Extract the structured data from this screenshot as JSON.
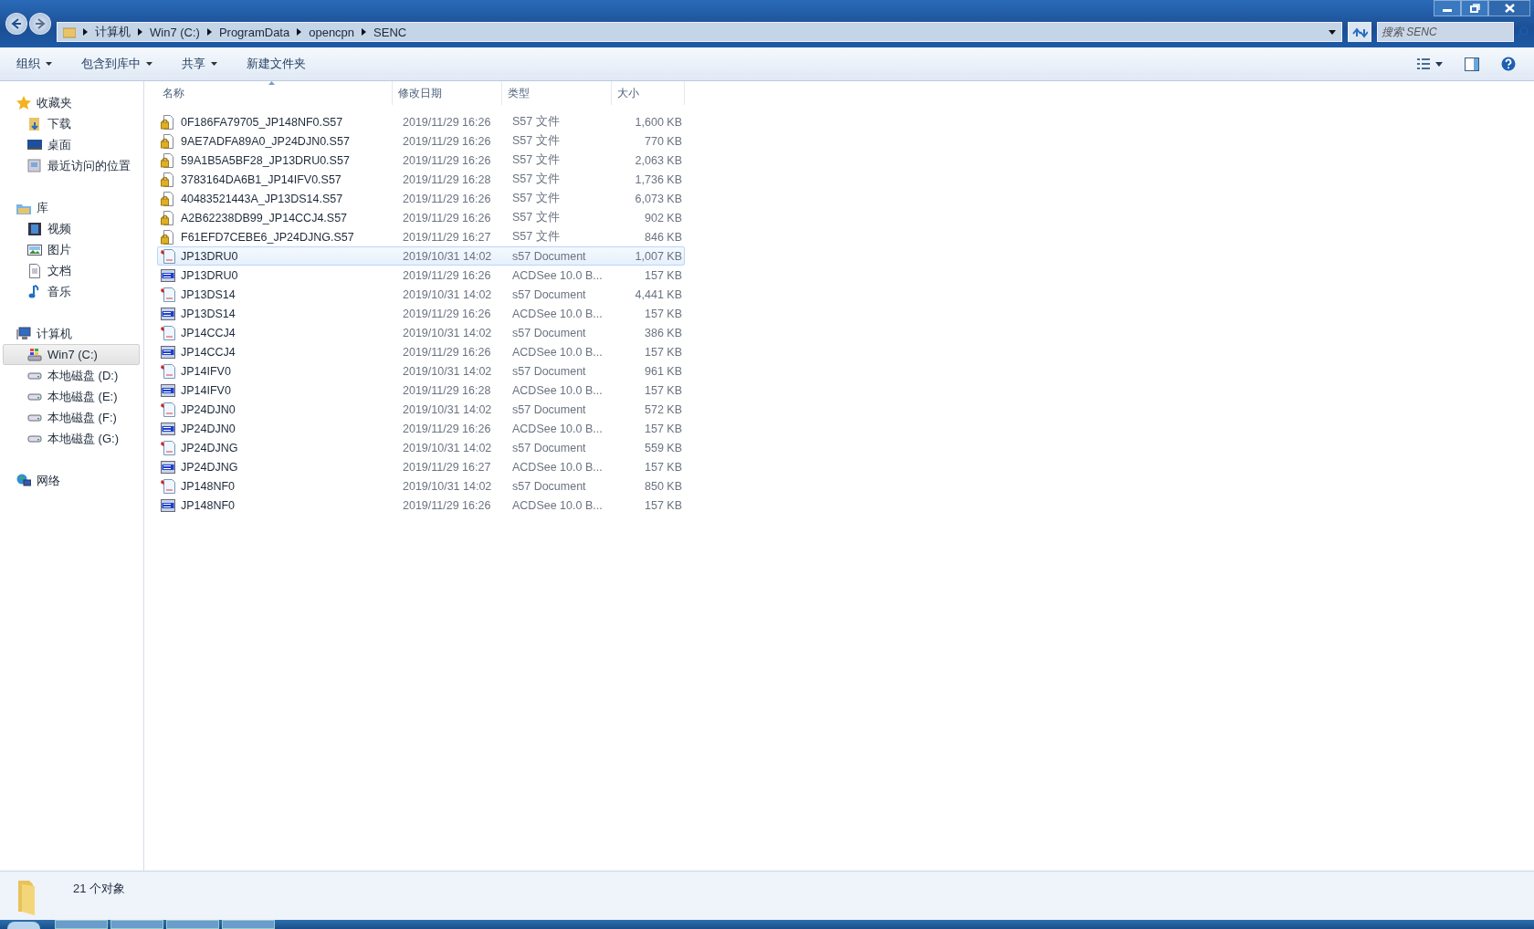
{
  "address_bar": {
    "breadcrumbs": [
      "计算机",
      "Win7 (C:)",
      "ProgramData",
      "opencpn",
      "SENC"
    ]
  },
  "search": {
    "placeholder": "搜索 SENC"
  },
  "toolbar": {
    "items": [
      {
        "label": "组织",
        "dropdown": true
      },
      {
        "label": "包含到库中",
        "dropdown": true
      },
      {
        "label": "共享",
        "dropdown": true
      },
      {
        "label": "新建文件夹",
        "dropdown": false
      }
    ]
  },
  "sidebar": {
    "groups": [
      {
        "label": "收藏夹",
        "kind": "favorites",
        "children": [
          {
            "label": "下载",
            "kind": "download",
            "selected": false
          },
          {
            "label": "桌面",
            "kind": "desktop",
            "selected": false
          },
          {
            "label": "最近访问的位置",
            "kind": "recent",
            "selected": false
          }
        ]
      },
      {
        "label": "库",
        "kind": "library",
        "children": [
          {
            "label": "视频",
            "kind": "video",
            "selected": false
          },
          {
            "label": "图片",
            "kind": "picture",
            "selected": false
          },
          {
            "label": "文档",
            "kind": "document",
            "selected": false
          },
          {
            "label": "音乐",
            "kind": "music",
            "selected": false
          }
        ]
      },
      {
        "label": "计算机",
        "kind": "computer",
        "children": [
          {
            "label": "Win7 (C:)",
            "kind": "system-drive",
            "selected": true
          },
          {
            "label": "本地磁盘 (D:)",
            "kind": "drive",
            "selected": false
          },
          {
            "label": "本地磁盘 (E:)",
            "kind": "drive",
            "selected": false
          },
          {
            "label": "本地磁盘 (F:)",
            "kind": "drive",
            "selected": false
          },
          {
            "label": "本地磁盘 (G:)",
            "kind": "drive",
            "selected": false
          }
        ]
      },
      {
        "label": "网络",
        "kind": "network"
      }
    ]
  },
  "table": {
    "columns": [
      "名称",
      "修改日期",
      "类型",
      "大小"
    ],
    "rows": [
      {
        "kind": "locked",
        "name": "0F186FA79705_JP148NF0.S57",
        "date": "2019/11/29 16:26",
        "type": "S57 文件",
        "size": "1,600 KB",
        "selected": false
      },
      {
        "kind": "locked",
        "name": "9AE7ADFA89A0_JP24DJN0.S57",
        "date": "2019/11/29 16:26",
        "type": "S57 文件",
        "size": "770 KB",
        "selected": false
      },
      {
        "kind": "locked",
        "name": "59A1B5A5BF28_JP13DRU0.S57",
        "date": "2019/11/29 16:26",
        "type": "S57 文件",
        "size": "2,063 KB",
        "selected": false
      },
      {
        "kind": "locked",
        "name": "3783164DA6B1_JP14IFV0.S57",
        "date": "2019/11/29 16:28",
        "type": "S57 文件",
        "size": "1,736 KB",
        "selected": false
      },
      {
        "kind": "locked",
        "name": "40483521443A_JP13DS14.S57",
        "date": "2019/11/29 16:26",
        "type": "S57 文件",
        "size": "6,073 KB",
        "selected": false
      },
      {
        "kind": "locked",
        "name": "A2B62238DB99_JP14CCJ4.S57",
        "date": "2019/11/29 16:26",
        "type": "S57 文件",
        "size": "902 KB",
        "selected": false
      },
      {
        "kind": "locked",
        "name": "F61EFD7CEBE6_JP24DJNG.S57",
        "date": "2019/11/29 16:27",
        "type": "S57 文件",
        "size": "846 KB",
        "selected": false
      },
      {
        "kind": "document",
        "name": "JP13DRU0",
        "date": "2019/10/31 14:02",
        "type": "s57 Document",
        "size": "1,007 KB",
        "selected": true
      },
      {
        "kind": "bmp",
        "name": "JP13DRU0",
        "date": "2019/11/29 16:26",
        "type": "ACDSee 10.0 B...",
        "size": "157 KB",
        "selected": false
      },
      {
        "kind": "document",
        "name": "JP13DS14",
        "date": "2019/10/31 14:02",
        "type": "s57 Document",
        "size": "4,441 KB",
        "selected": false
      },
      {
        "kind": "bmp",
        "name": "JP13DS14",
        "date": "2019/11/29 16:26",
        "type": "ACDSee 10.0 B...",
        "size": "157 KB",
        "selected": false
      },
      {
        "kind": "document",
        "name": "JP14CCJ4",
        "date": "2019/10/31 14:02",
        "type": "s57 Document",
        "size": "386 KB",
        "selected": false
      },
      {
        "kind": "bmp",
        "name": "JP14CCJ4",
        "date": "2019/11/29 16:26",
        "type": "ACDSee 10.0 B...",
        "size": "157 KB",
        "selected": false
      },
      {
        "kind": "document",
        "name": "JP14IFV0",
        "date": "2019/10/31 14:02",
        "type": "s57 Document",
        "size": "961 KB",
        "selected": false
      },
      {
        "kind": "bmp",
        "name": "JP14IFV0",
        "date": "2019/11/29 16:28",
        "type": "ACDSee 10.0 B...",
        "size": "157 KB",
        "selected": false
      },
      {
        "kind": "document",
        "name": "JP24DJN0",
        "date": "2019/10/31 14:02",
        "type": "s57 Document",
        "size": "572 KB",
        "selected": false
      },
      {
        "kind": "bmp",
        "name": "JP24DJN0",
        "date": "2019/11/29 16:26",
        "type": "ACDSee 10.0 B...",
        "size": "157 KB",
        "selected": false
      },
      {
        "kind": "document",
        "name": "JP24DJNG",
        "date": "2019/10/31 14:02",
        "type": "s57 Document",
        "size": "559 KB",
        "selected": false
      },
      {
        "kind": "bmp",
        "name": "JP24DJNG",
        "date": "2019/11/29 16:27",
        "type": "ACDSee 10.0 B...",
        "size": "157 KB",
        "selected": false
      },
      {
        "kind": "document",
        "name": "JP148NF0",
        "date": "2019/10/31 14:02",
        "type": "s57 Document",
        "size": "850 KB",
        "selected": false
      },
      {
        "kind": "bmp",
        "name": "JP148NF0",
        "date": "2019/11/29 16:26",
        "type": "ACDSee 10.0 B...",
        "size": "157 KB",
        "selected": false
      }
    ]
  },
  "status_bar": {
    "text": "21 个对象"
  }
}
